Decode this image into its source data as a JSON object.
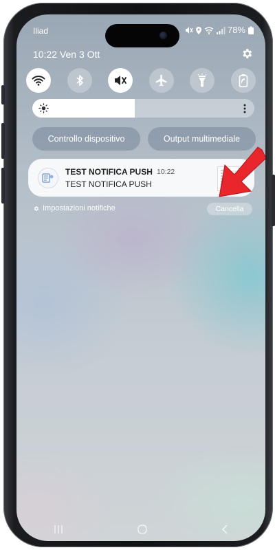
{
  "status_bar": {
    "carrier": "Iliad",
    "battery": "78%"
  },
  "header": {
    "datetime": "10:22  Ven 3 Ott",
    "settings_icon": "gear-icon"
  },
  "quick_settings": [
    {
      "name": "wifi-icon",
      "active": true
    },
    {
      "name": "bluetooth-icon",
      "active": false
    },
    {
      "name": "mute-icon",
      "active": true
    },
    {
      "name": "airplane-icon",
      "active": false
    },
    {
      "name": "flashlight-icon",
      "active": false
    },
    {
      "name": "power-saving-icon",
      "active": false
    }
  ],
  "brightness": {
    "level": 0.46
  },
  "pills": {
    "device_control": "Controllo dispositivo",
    "media_output": "Output multimediale"
  },
  "notification": {
    "title": "TEST NOTIFICA PUSH",
    "time": "10:22",
    "body": "TEST NOTIFICA PUSH"
  },
  "footer": {
    "settings_label": "Impostazioni notifiche",
    "clear_label": "Cancella"
  },
  "nav_bar": [
    "recents-icon",
    "home-icon",
    "back-icon"
  ],
  "colors": {
    "arrow": "#e8262b",
    "active_tile": "#ffffff"
  }
}
